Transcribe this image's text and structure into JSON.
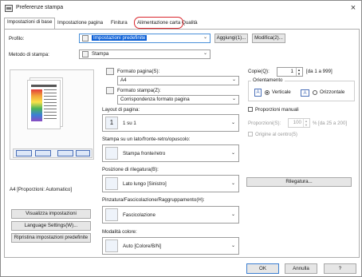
{
  "window": {
    "title": "Preferenze stampa",
    "close_label": "×"
  },
  "tabs": [
    {
      "label": "Impostazioni di base"
    },
    {
      "label": "Impostazione pagina"
    },
    {
      "label": "Finitura"
    },
    {
      "label": "Alimentazione carta"
    },
    {
      "label": "Qualità"
    }
  ],
  "profile": {
    "label": "Profilo:",
    "value": "Impostazioni predefinite",
    "add_button": "Aggiungi(1)...",
    "edit_button": "Modifica(2)..."
  },
  "print_method": {
    "label": "Metodo di stampa:",
    "value": "Stampa"
  },
  "page_size": {
    "label": "Formato pagina(S):",
    "value": "A4"
  },
  "output_size": {
    "label": "Formato stampa(Z):",
    "value": "Corrispondenza formato pagina"
  },
  "layout": {
    "label": "Layout di pagina:",
    "value": "1 su 1",
    "icon_text": "1"
  },
  "duplex": {
    "label": "Stampa su un lato/fronte-retro/opuscolo:",
    "value": "Stampa fronte/retro"
  },
  "binding": {
    "label": "Posizione di rilegatura(B):",
    "value": "Lato lungo [Sinistro]",
    "button": "Rilegatura..."
  },
  "finishing": {
    "label": "Pinzatura/Fascicolazione/Raggruppamento(H):",
    "value": "Fascicolazione"
  },
  "color_mode": {
    "label": "Modalità colore:",
    "value": "Auto [Colore/B/N]"
  },
  "copies": {
    "label": "Copie(Q):",
    "value": "1",
    "range": "[da 1 a 999]"
  },
  "orientation": {
    "label": "Orientamento",
    "portrait": "Verticale",
    "landscape": "Orizzontale",
    "selected": "Verticale"
  },
  "manual_scaling": {
    "label": "Proporzioni manuali",
    "scaling_label": "Proporzioni(S):",
    "scaling_value": "100",
    "scaling_unit": "%",
    "scaling_range": "[da 25 a 200]",
    "center_label": "Origine al centro(5)"
  },
  "preview": {
    "caption": "A4 [Proporzioni: Automatico]"
  },
  "left_buttons": {
    "view_settings": "Visualizza impostazioni",
    "language": "Language Settings(W)...",
    "restore": "Ripristina impostazioni predefinite"
  },
  "footer": {
    "ok": "OK",
    "cancel": "Annulla",
    "help": "?"
  },
  "colors": {
    "accent": "#0b5fd6",
    "highlight_ring": "#d9262c",
    "border": "#9c9c9c"
  },
  "icons": [
    "printer-icon",
    "paper-icon",
    "landscape-icon",
    "duplex-icon",
    "binding-icon",
    "collate-icon",
    "color-icon"
  ]
}
